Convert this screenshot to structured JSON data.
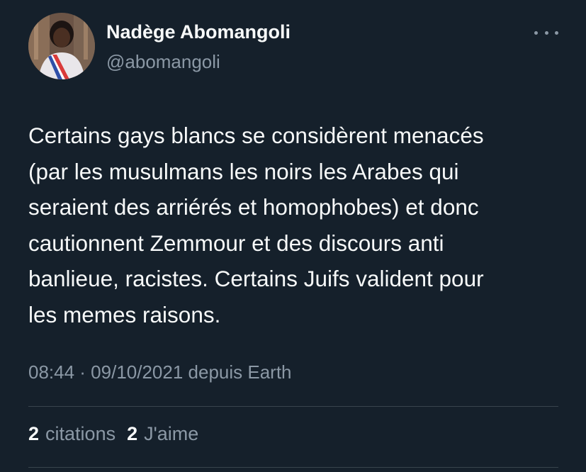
{
  "tweet": {
    "author_name": "Nadège Abomangoli",
    "author_handle": "@abomangoli",
    "more_icon": "ellipsis-icon",
    "body_lines": [
      "Certains gays blancs se considèrent menacés",
      "(par les musulmans les noirs les Arabes qui",
      "seraient des arriérés et homophobes) et donc",
      "cautionnent Zemmour et des discours anti",
      "banlieue, racistes. Certains Juifs valident pour",
      "les memes raisons."
    ],
    "meta": "08:44 · 09/10/2021 depuis Earth",
    "stats": {
      "quotes_count": "2",
      "quotes_label": "citations",
      "likes_count": "2",
      "likes_label": "J'aime"
    }
  },
  "colors": {
    "background": "#15202b",
    "primary_text": "#f7f9f9",
    "secondary_text": "#8b98a5",
    "divider": "#38444d"
  }
}
